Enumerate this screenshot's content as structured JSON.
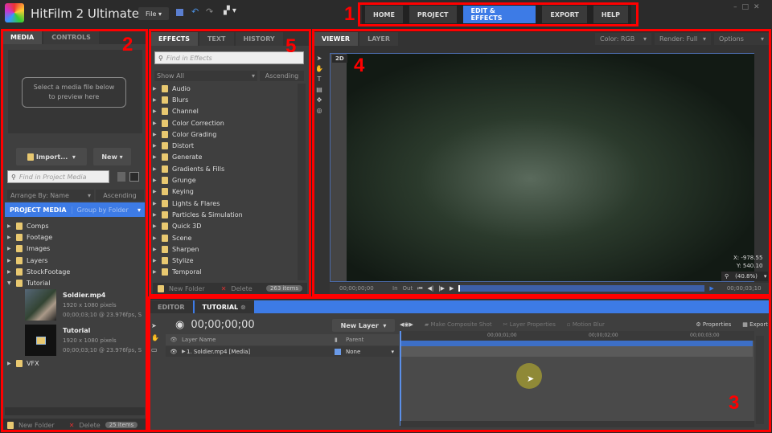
{
  "app": {
    "title": "HitFilm 2 Ultimate",
    "file_menu": "File"
  },
  "nav": [
    {
      "label": "HOME"
    },
    {
      "label": "PROJECT"
    },
    {
      "label": "EDIT & EFFECTS",
      "active": true
    },
    {
      "label": "EXPORT"
    },
    {
      "label": "HELP"
    }
  ],
  "media_panel": {
    "tabs": [
      "MEDIA",
      "CONTROLS"
    ],
    "preview_hint": "Select a media file below to preview here",
    "import": "Import...",
    "new": "New",
    "search_placeholder": "Find in Project Media",
    "arrange": "Arrange By: Name",
    "order": "Ascending",
    "header": "PROJECT MEDIA",
    "group": "Group by Folder",
    "folders_top": [
      "Comps",
      "Footage",
      "Images",
      "Layers",
      "StockFootage",
      "Tutorial"
    ],
    "items": [
      {
        "name": "Soldier.mp4",
        "res": "1920 x 1080 pixels",
        "info": "00;00;03;10 @ 23.976fps, S"
      },
      {
        "name": "Tutorial",
        "res": "1920 x 1080 pixels",
        "info": "00;00;03;10 @ 23.976fps, S"
      }
    ],
    "folder_bottom": "VFX",
    "new_folder": "New Folder",
    "delete": "Delete",
    "count": "25 items"
  },
  "effects_panel": {
    "tabs": [
      "EFFECTS",
      "TEXT",
      "HISTORY"
    ],
    "search_placeholder": "Find in Effects",
    "filter": "Show All",
    "order": "Ascending",
    "categories": [
      "Audio",
      "Blurs",
      "Channel",
      "Color Correction",
      "Color Grading",
      "Distort",
      "Generate",
      "Gradients & Fills",
      "Grunge",
      "Keying",
      "Lights & Flares",
      "Particles & Simulation",
      "Quick 3D",
      "Scene",
      "Sharpen",
      "Stylize",
      "Temporal"
    ],
    "new_folder": "New Folder",
    "delete": "Delete",
    "count": "263 items"
  },
  "viewer": {
    "tabs": [
      "VIEWER",
      "LAYER"
    ],
    "color": "Color: RGB",
    "render": "Render: Full",
    "options": "Options",
    "mode": "2D",
    "x": "X:  -978.55",
    "y": "Y:   540.10",
    "zoom": "(40.8%)",
    "time_start": "00;00;00;00",
    "in": "In",
    "out": "Out",
    "time_end": "00;00;03;10",
    "playhead_fraction": 0.0
  },
  "timeline": {
    "tabs": [
      "EDITOR",
      "TUTORIAL"
    ],
    "timecode": "00;00;00;00",
    "new_layer": "New Layer",
    "make_composite": "Make Composite Shot",
    "layer_properties": "Layer Properties",
    "motion_blur": "Motion Blur",
    "properties": "Properties",
    "export": "Export",
    "col_name": "Layer Name",
    "col_parent": "Parent",
    "layer": "1. Soldier.mp4 [Media]",
    "parent": "None",
    "ticks": [
      "00;00;01;00",
      "00;00;02;00",
      "00;00;03;00"
    ]
  },
  "annotations": [
    "1",
    "2",
    "3",
    "4",
    "5"
  ],
  "colors": {
    "accent": "#3d7be6",
    "annotation": "#ff0000",
    "panel": "#3f3f3f"
  }
}
